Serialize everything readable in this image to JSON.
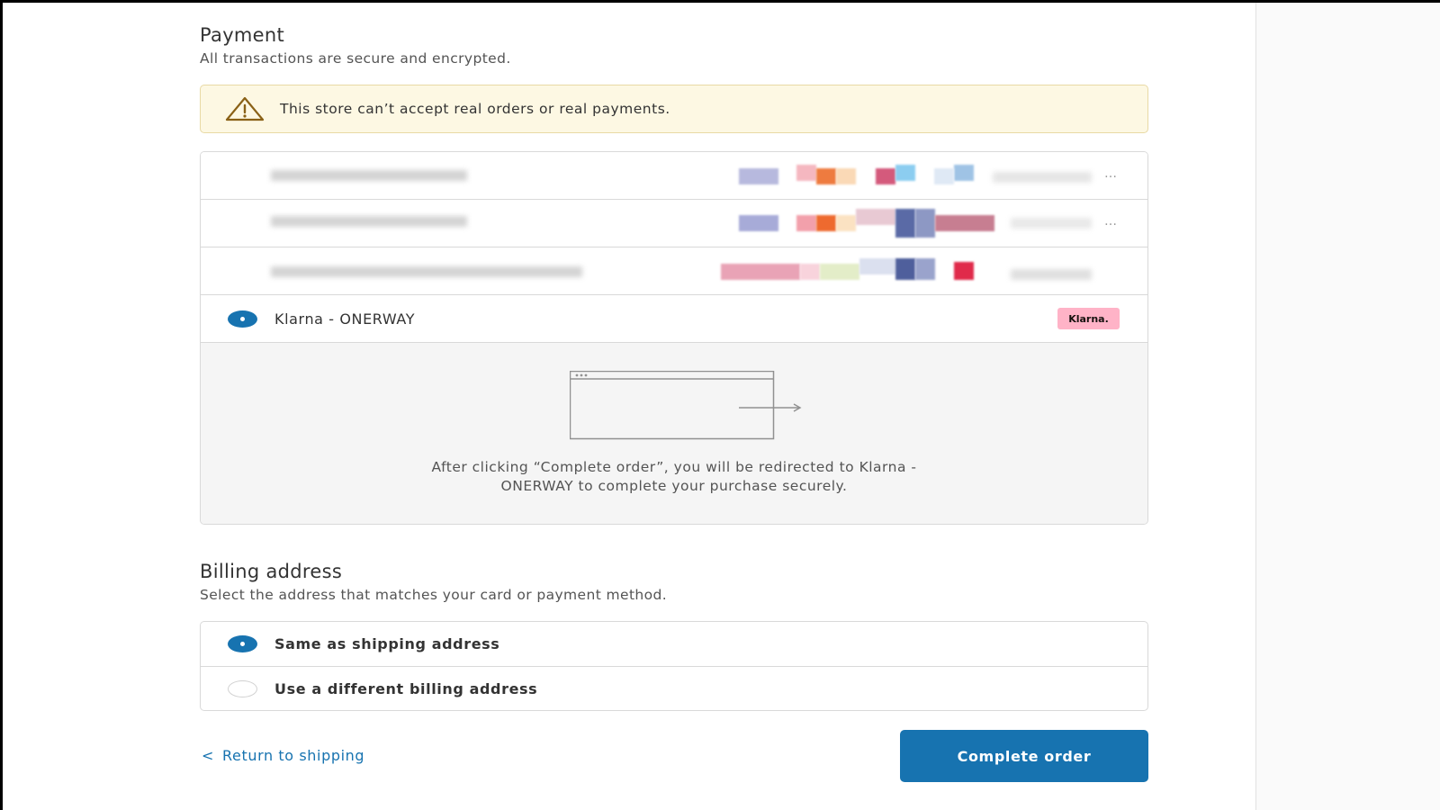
{
  "payment": {
    "title": "Payment",
    "subtitle": "All transactions are secure and encrypted."
  },
  "alert": {
    "icon": "warning-icon",
    "message": "This store can’t accept real orders or real payments.",
    "color": "#fdf8e3"
  },
  "methods": {
    "blurred_rows": 3,
    "selected": {
      "label": "Klarna - ONERWAY",
      "badge": "Klarna.",
      "badge_color": "#ffb3c7"
    },
    "redirect_text_line1": "After clicking “Complete order”, you will be redirected to Klarna -",
    "redirect_text_line2": "ONERWAY to complete your purchase securely."
  },
  "billing": {
    "title": "Billing address",
    "subtitle": "Select the address that matches your card or payment method.",
    "options": [
      {
        "label": "Same as shipping address",
        "selected": true
      },
      {
        "label": "Use a different billing address",
        "selected": false
      }
    ]
  },
  "footer": {
    "return_label": "Return to shipping",
    "complete_label": "Complete order",
    "accent": "#1773b0"
  }
}
